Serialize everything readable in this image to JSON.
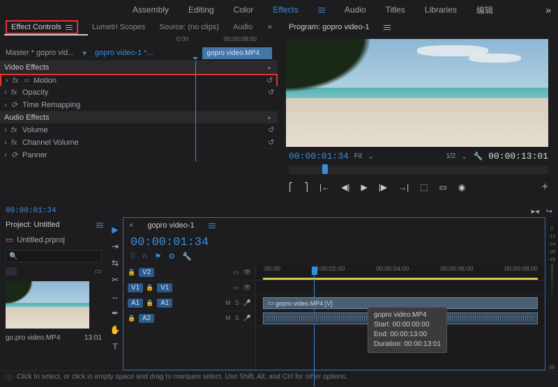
{
  "workspace_tabs": [
    "Assembly",
    "Editing",
    "Color",
    "Effects",
    "Audio",
    "Titles",
    "Libraries",
    "编辑"
  ],
  "workspace_active": "Effects",
  "effect_controls": {
    "tabs": [
      "Effect Controls",
      "Lumetri Scopes",
      "Source: (no clips)",
      "Audio"
    ],
    "master_label": "Master * gopro vid...",
    "source_label": "gopro video-1 *...",
    "ruler": [
      "0:00",
      "00:00:08:00"
    ],
    "clip_name": "gopro video.MP4",
    "groups": {
      "video": "Video Effects",
      "audio": "Audio Effects"
    },
    "video_fx": [
      "Motion",
      "Opacity",
      "Time Remapping"
    ],
    "audio_fx": [
      "Volume",
      "Channel Volume",
      "Panner"
    ]
  },
  "program": {
    "title": "Program: gopro video-1",
    "current_tc": "00:00:01:34",
    "fit_label": "Fit",
    "zoom_label": "1/2",
    "duration_tc": "00:00:13:01"
  },
  "source_tc": "00:00:01:34",
  "project": {
    "title": "Project: Untitled",
    "file": "Untitled.prproj",
    "search_placeholder": "",
    "clip_name": "go.pro video.MP4",
    "clip_dur": "13:01"
  },
  "timeline": {
    "seq_name": "gopro video-1",
    "current_tc": "00:00:01:34",
    "ruler": [
      ":00:00",
      "00:00:02:00",
      "00:00:04:00",
      "00:00:06:00",
      "00:00:08:00"
    ],
    "tracks": {
      "v2": "V2",
      "v1": "V1",
      "a1_src": "A1",
      "v1_src": "V1",
      "a1": "A1",
      "a2": "A2"
    },
    "video_clip": "gopro video.MP4 [V]",
    "tooltip": {
      "name": "gopro video.MP4",
      "start": "Start: 00:00:00:00",
      "end": "End: 00:00:13:00",
      "duration": "Duration: 00:00:13:01"
    }
  },
  "meters": [
    "0",
    "-12",
    "-24",
    "-36",
    "-48",
    "dB"
  ],
  "status": "Click to select, or click in empty space and drag to marquee select. Use Shift, Alt, and Ctrl for other options."
}
